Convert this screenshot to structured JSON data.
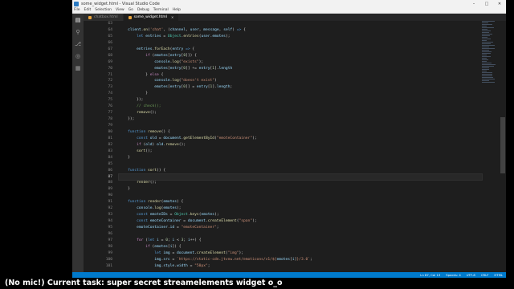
{
  "window": {
    "title": "some_widget.html - Visual Studio Code"
  },
  "menu": [
    "File",
    "Edit",
    "Selection",
    "View",
    "Go",
    "Debug",
    "Terminal",
    "Help"
  ],
  "tabs": [
    {
      "label": "chatbox.html",
      "active": false
    },
    {
      "label": "some_widget.html",
      "active": true
    }
  ],
  "editor": {
    "current_line": "87",
    "lines": [
      {
        "n": "63",
        "html": ""
      },
      {
        "n": "64",
        "html": "    <span class=\"var\">client</span>.<span class=\"fn\">on</span>(<span class=\"str\">'chat'</span>, (<span class=\"var\">channel</span>, <span class=\"var\">user</span>, <span class=\"var\">message</span>, <span class=\"var\">self</span>) <span class=\"kw\">=&gt;</span> {"
      },
      {
        "n": "65",
        "html": "        <span class=\"kw\">let</span> <span class=\"var\">entries</span> = <span class=\"obj\">Object</span>.<span class=\"fn\">entries</span>(<span class=\"var\">user</span>.<span class=\"var\">emotes</span>);"
      },
      {
        "n": "66",
        "html": ""
      },
      {
        "n": "67",
        "html": "        <span class=\"var\">entries</span>.<span class=\"fn\">forEach</span>(<span class=\"var\">entry</span> <span class=\"kw\">=&gt;</span> {"
      },
      {
        "n": "68",
        "html": "            <span class=\"ctl\">if</span> (<span class=\"var\">emotes</span>[<span class=\"var\">entry</span>[<span class=\"num\">0</span>]]) {"
      },
      {
        "n": "69",
        "html": "                <span class=\"var\">console</span>.<span class=\"fn\">log</span>(<span class=\"str\">\"exists\"</span>);"
      },
      {
        "n": "70",
        "html": "                <span class=\"var\">emotes</span>[<span class=\"var\">entry</span>[<span class=\"num\">0</span>]] += <span class=\"var\">entry</span>[<span class=\"num\">1</span>].<span class=\"var\">length</span>"
      },
      {
        "n": "71",
        "html": "            } <span class=\"ctl\">else</span> {"
      },
      {
        "n": "72",
        "html": "                <span class=\"var\">console</span>.<span class=\"fn\">log</span>(<span class=\"str\">\"doesn't exist\"</span>)"
      },
      {
        "n": "73",
        "html": "                <span class=\"var\">emotes</span>[<span class=\"var\">entry</span>[<span class=\"num\">0</span>]] = <span class=\"var\">entry</span>[<span class=\"num\">1</span>].<span class=\"var\">length</span>;"
      },
      {
        "n": "74",
        "html": "            }"
      },
      {
        "n": "75",
        "html": "        });"
      },
      {
        "n": "76",
        "html": "        <span class=\"cmt\">// check();</span>"
      },
      {
        "n": "77",
        "html": "        <span class=\"fn\">remove</span>();"
      },
      {
        "n": "78",
        "html": "    });"
      },
      {
        "n": "79",
        "html": ""
      },
      {
        "n": "80",
        "html": "    <span class=\"kw\">function</span> <span class=\"fn\">remove</span>() {"
      },
      {
        "n": "81",
        "html": "        <span class=\"kw\">const</span> <span class=\"var\">old</span> = <span class=\"var\">document</span>.<span class=\"fn\">getElementById</span>(<span class=\"str\">\"emoteContainer\"</span>);"
      },
      {
        "n": "82",
        "html": "        <span class=\"ctl\">if</span> (<span class=\"var\">old</span>) <span class=\"var\">old</span>.<span class=\"fn\">remove</span>();"
      },
      {
        "n": "83",
        "html": "        <span class=\"fn\">sort</span>();"
      },
      {
        "n": "84",
        "html": "    }"
      },
      {
        "n": "85",
        "html": ""
      },
      {
        "n": "86",
        "html": "    <span class=\"kw\">function</span> <span class=\"fn\">sort</span>() {"
      },
      {
        "n": "87",
        "html": "        "
      },
      {
        "n": "88",
        "html": "        <span class=\"fn\">render</span>();"
      },
      {
        "n": "89",
        "html": "    }"
      },
      {
        "n": "90",
        "html": ""
      },
      {
        "n": "91",
        "html": "    <span class=\"kw\">function</span> <span class=\"fn\">render</span>(<span class=\"var\">emotes</span>) {"
      },
      {
        "n": "92",
        "html": "        <span class=\"var\">console</span>.<span class=\"fn\">log</span>(<span class=\"var\">emotes</span>);"
      },
      {
        "n": "93",
        "html": "        <span class=\"kw\">const</span> <span class=\"var\">emoteIDs</span> = <span class=\"obj\">Object</span>.<span class=\"fn\">keys</span>(<span class=\"var\">emotes</span>);"
      },
      {
        "n": "94",
        "html": "        <span class=\"kw\">const</span> <span class=\"var\">emoteContainer</span> = <span class=\"var\">document</span>.<span class=\"fn\">createElement</span>(<span class=\"str\">\"span\"</span>);"
      },
      {
        "n": "95",
        "html": "        <span class=\"var\">emoteContainer</span>.<span class=\"var\">id</span> = <span class=\"str\">\"emoteContainer\"</span>;"
      },
      {
        "n": "96",
        "html": ""
      },
      {
        "n": "97",
        "html": "        <span class=\"ctl\">for</span> (<span class=\"kw\">let</span> <span class=\"var\">i</span> = <span class=\"num\">0</span>; <span class=\"var\">i</span> &lt; <span class=\"num\">3</span>; <span class=\"var\">i</span>++) {"
      },
      {
        "n": "98",
        "html": "            <span class=\"ctl\">if</span> (<span class=\"var\">emotes</span>[<span class=\"var\">i</span>]) {"
      },
      {
        "n": "99",
        "html": "                <span class=\"kw\">let</span> <span class=\"var\">img</span> = <span class=\"var\">document</span>.<span class=\"fn\">createElement</span>(<span class=\"str\">\"img\"</span>);"
      },
      {
        "n": "100",
        "html": "                <span class=\"var\">img</span>.<span class=\"var\">src</span> = <span class=\"str\">`https://static-cdn.jtvnw.net/emoticons/v1/${</span><span class=\"var\">emotes</span>[<span class=\"var\">i</span>]<span class=\"str\">}/3.0`</span>;"
      },
      {
        "n": "101",
        "html": "                <span class=\"var\">img</span>.<span class=\"var\">style</span>.<span class=\"var\">width</span> = <span class=\"str\">\"50px\"</span>;"
      }
    ]
  },
  "status": {
    "position": "Ln 87, Col 13",
    "spaces": "Spaces: 4",
    "encoding": "UTF-8",
    "eol": "CRLF",
    "language": "HTML"
  },
  "caption": "(No mic!) Current task: super secret streamelements widget o_o",
  "colors": {
    "status_bar": "#007acc",
    "editor_bg": "#1e1e1e",
    "activity_bar": "#333333"
  }
}
